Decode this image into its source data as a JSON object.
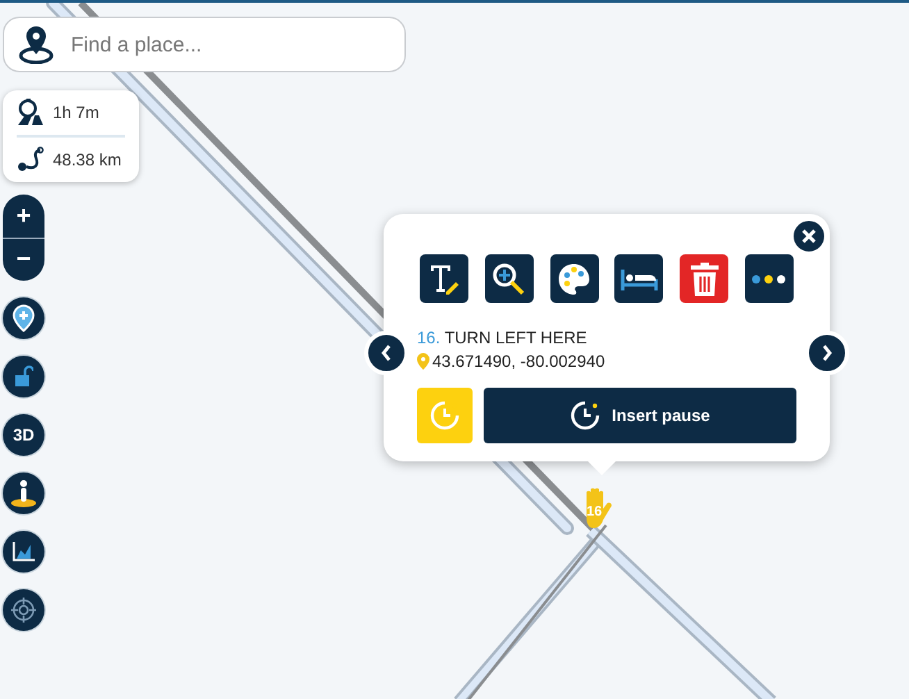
{
  "search": {
    "placeholder": "Find a place..."
  },
  "stats": [
    {
      "kind": "duration",
      "text": "1h 7m"
    },
    {
      "kind": "distance",
      "text": "48.38 km"
    }
  ],
  "zoom": {
    "in": "+",
    "out": "−"
  },
  "map_controls": [
    {
      "kind": "pin"
    },
    {
      "kind": "lock"
    },
    {
      "kind": "threed",
      "text": "3D"
    },
    {
      "kind": "person"
    },
    {
      "kind": "chart"
    },
    {
      "kind": "target"
    }
  ],
  "popup": {
    "tools": [
      {
        "kind": "text"
      },
      {
        "kind": "zoom"
      },
      {
        "kind": "palette"
      },
      {
        "kind": "bed"
      },
      {
        "kind": "delete"
      },
      {
        "kind": "more"
      }
    ],
    "step_number": "16.",
    "step_title": "TURN LEFT HERE",
    "coordinates": "43.671490, -80.002940",
    "pause_button": "Insert pause"
  },
  "marker": {
    "label": "16"
  }
}
